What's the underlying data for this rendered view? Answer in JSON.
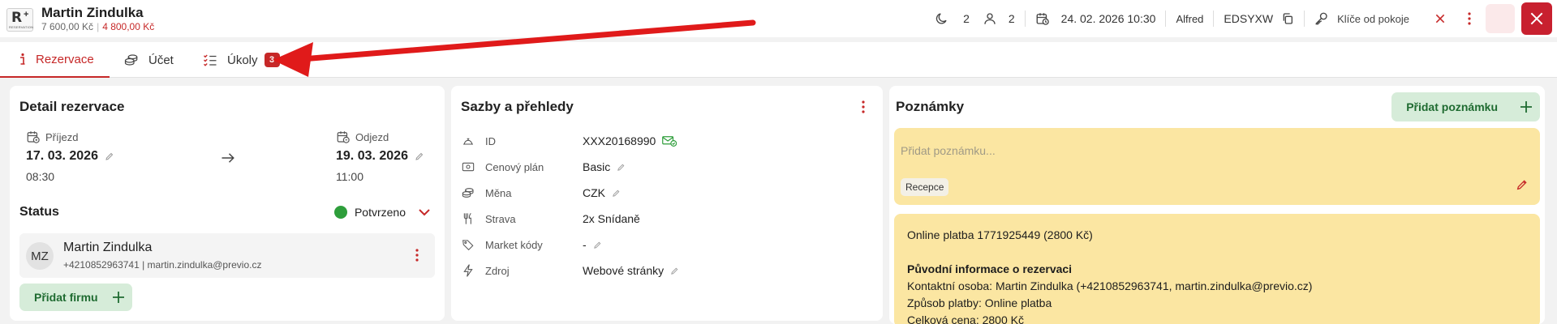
{
  "header": {
    "logo": {
      "letter": "R",
      "plus": "+",
      "tiny": "RESERVATION"
    },
    "guest_name": "Martin Zindulka",
    "amount_total": "7 600,00 Kč",
    "amount_due": "4 800,00 Kč",
    "adults": "2",
    "children": "2",
    "datetime": "24. 02. 2026 10:30",
    "user": "Alfred",
    "code": "EDSYXW",
    "keys_label": "Klíče od pokoje"
  },
  "tabs": [
    {
      "label": "Rezervace",
      "active": true
    },
    {
      "label": "Účet",
      "active": false
    },
    {
      "label": "Úkoly",
      "active": false,
      "badge": "3"
    }
  ],
  "detail": {
    "title": "Detail rezervace",
    "arrival_label": "Příjezd",
    "arrival_date": "17. 03. 2026",
    "arrival_time": "08:30",
    "departure_label": "Odjezd",
    "departure_date": "19. 03. 2026",
    "departure_time": "11:00",
    "status_label": "Status",
    "status_value": "Potvrzeno",
    "guest_initials": "MZ",
    "guest_name": "Martin Zindulka",
    "guest_contact": "+4210852963741 | martin.zindulka@previo.cz",
    "add_company": "Přidat firmu"
  },
  "rates": {
    "title": "Sazby a přehledy",
    "rows": [
      {
        "label": "ID",
        "value": "XXX20168990",
        "icon": "bell-icon"
      },
      {
        "label": "Cenový plán",
        "value": "Basic",
        "icon": "money-icon"
      },
      {
        "label": "Měna",
        "value": "CZK",
        "icon": "coins-icon"
      },
      {
        "label": "Strava",
        "value": "2x Snídaně",
        "icon": "cutlery-icon"
      },
      {
        "label": "Market kódy",
        "value": "-",
        "icon": "tag-icon"
      },
      {
        "label": "Zdroj",
        "value": "Webové stránky",
        "icon": "bolt-icon"
      }
    ]
  },
  "notes": {
    "title": "Poznámky",
    "add_note": "Přidat poznámku",
    "placeholder": "Přidat poznámku...",
    "chip": "Recepce",
    "note_lines": [
      "Online platba 1771925449 (2800 Kč)",
      "",
      "Původní informace o rezervaci",
      "Kontaktní osoba: Martin Zindulka (+4210852963741, martin.zindulka@previo.cz)",
      "Způsob platby: Online platba",
      "Celková cena: 2800 Kč"
    ]
  },
  "colors": {
    "accent_red": "#c62828",
    "note_yellow": "#fbe6a2",
    "status_green": "#2e9e3b"
  }
}
